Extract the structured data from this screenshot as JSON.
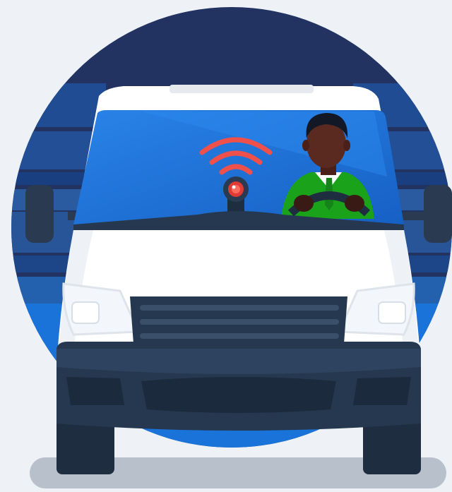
{
  "illustration": {
    "icons": [
      "wireless-signal-icon",
      "dash-camera-icon",
      "driver-figure",
      "delivery-van"
    ],
    "colors": {
      "background": "#eef2f7",
      "circle_top": "#223361",
      "circle_bottom": "#1a73d9",
      "windshield": "#1f6fd6",
      "van_body": "#ffffff",
      "bumper": "#26384f",
      "signal": "#f0504a",
      "driver_suit": "#1aa31a",
      "driver_skin": "#5a2a20",
      "ground_shadow": "#b8c0cb"
    }
  }
}
